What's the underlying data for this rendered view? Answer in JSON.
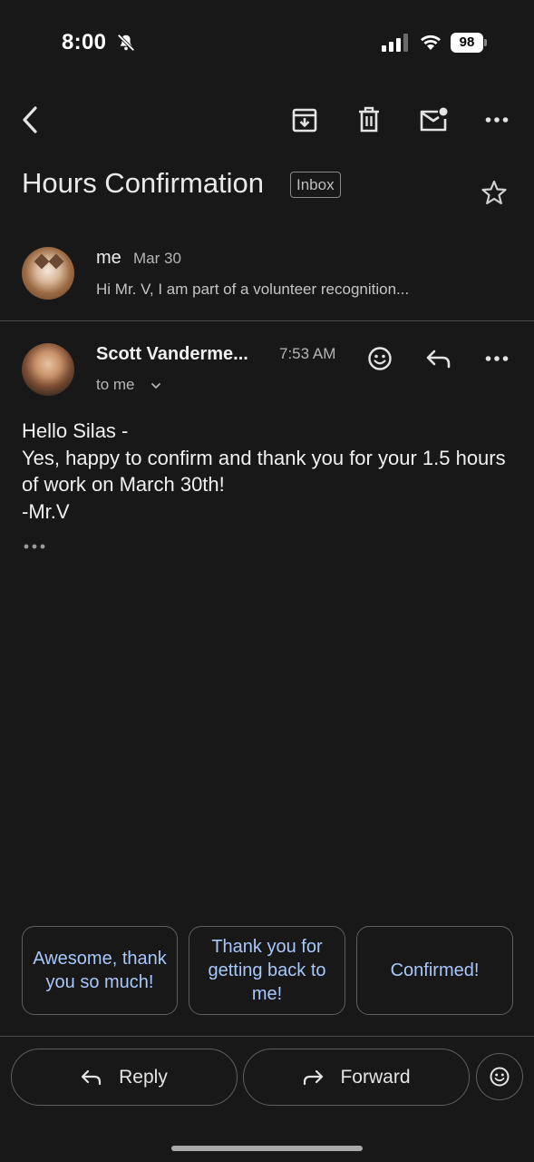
{
  "status_bar": {
    "time": "8:00",
    "battery": "98"
  },
  "toolbar": {
    "back_icon": "back-arrow-icon",
    "archive_icon": "archive-icon",
    "delete_icon": "trash-icon",
    "unread_icon": "mark-unread-icon",
    "more_icon": "more-horizontal-icon"
  },
  "thread": {
    "subject": "Hours Confirmation",
    "label": "Inbox"
  },
  "collapsed_message": {
    "sender": "me",
    "date": "Mar 30",
    "snippet": "Hi Mr. V, I am part of a volunteer recognition..."
  },
  "message": {
    "sender": "Scott Vanderme...",
    "time": "7:53 AM",
    "recipient": "to me",
    "body": [
      "Hello Silas -",
      "Yes, happy to confirm and thank you for your 1.5 hours of work on March 30th!",
      "-Mr.V"
    ]
  },
  "smart_replies": [
    "Awesome, thank you so much!",
    "Thank you for getting back to me!",
    "Confirmed!"
  ],
  "actions": {
    "reply_label": "Reply",
    "forward_label": "Forward"
  },
  "colors": {
    "background": "#181818",
    "smart_reply_text": "#a8c7fa",
    "border": "#5e5e5e"
  }
}
